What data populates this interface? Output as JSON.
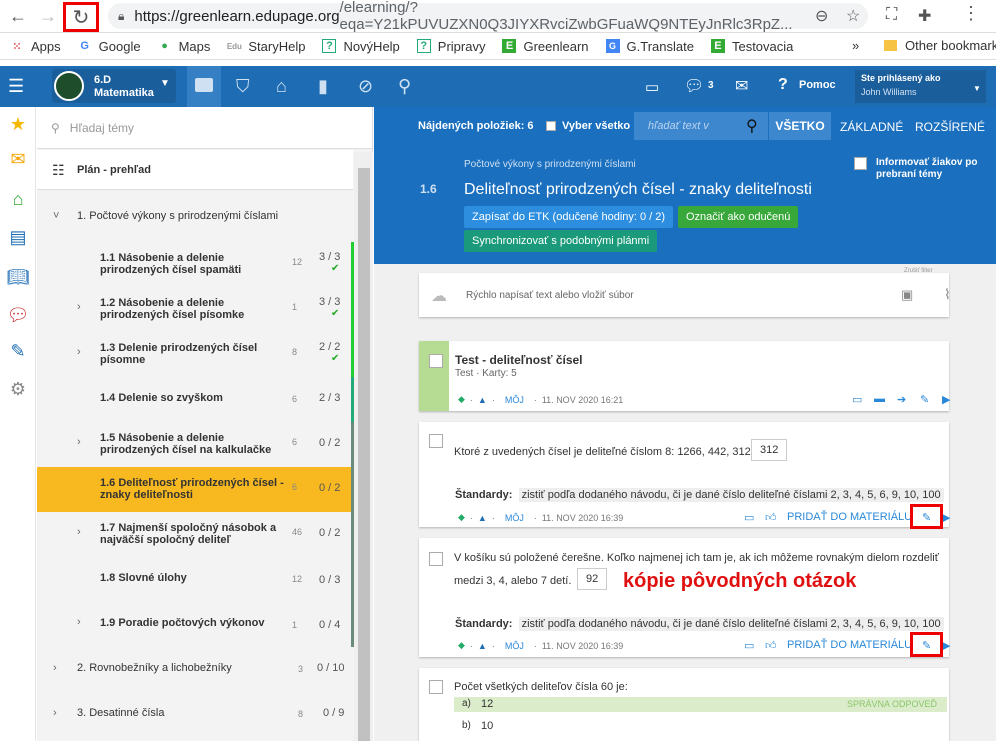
{
  "browser": {
    "url_domain": "https://greenlearn.edupage.org",
    "url_path": "/elearning/?eqa=Y21kPUVUZXN0Q3JIYXRvciZwbGFuaWQ9NTEyJnRlc3RpZ..."
  },
  "bookmarks": [
    {
      "label": "Apps",
      "icon": "apps-grid-icon"
    },
    {
      "label": "Google",
      "icon": "google-icon"
    },
    {
      "label": "Maps",
      "icon": "maps-pin-icon"
    },
    {
      "label": "StaryHelp",
      "icon": "edu-icon"
    },
    {
      "label": "NovýHelp",
      "icon": "help-question-icon"
    },
    {
      "label": "Pripravy",
      "icon": "help-question-icon"
    },
    {
      "label": "Greenlearn",
      "icon": "greenlearn-icon"
    },
    {
      "label": "G.Translate",
      "icon": "translate-icon"
    },
    {
      "label": "Testovacia",
      "icon": "greenlearn-icon"
    }
  ],
  "bookmarks_other": "Other bookmarks",
  "app": {
    "class_name": "6.D",
    "subject": "Matematika",
    "messages_count": "3",
    "help_label": "Pomoc",
    "logged_in_label": "Ste prihlásený ako",
    "user_name": "John Williams"
  },
  "plan": {
    "search_placeholder": "Hľadaj témy",
    "overview_label": "Plán - prehľad",
    "chapter1": "1. Počtové výkony s prirodzenými číslami",
    "topics": [
      {
        "title": "1.1  Násobenie a delenie prirodzených čísel spamäti",
        "count": "12",
        "score": "3 / 3",
        "done": "✔"
      },
      {
        "title": "1.2  Násobenie a delenie prirodzených čísel písomke",
        "count": "1",
        "score": "3 / 3",
        "done": "✔"
      },
      {
        "title": "1.3  Delenie prirodzených čísel písomne",
        "count": "8",
        "score": "2 / 2",
        "done": "✔"
      },
      {
        "title": "1.4  Delenie so zvyškom",
        "count": "6",
        "score": "2 / 3",
        "done": ""
      },
      {
        "title": "1.5  Násobenie a delenie prirodzených čísel na kalkulačke",
        "count": "6",
        "score": "0 / 2",
        "done": ""
      },
      {
        "title": "1.6  Deliteľnosť prirodzených čísel - znaky deliteľnosti",
        "count": "6",
        "score": "0 / 2",
        "done": ""
      },
      {
        "title": "1.7  Najmenší spoločný násobok a najväčší spoločný deliteľ",
        "count": "46",
        "score": "0 / 2",
        "done": ""
      },
      {
        "title": "1.8  Slovné úlohy",
        "count": "12",
        "score": "0 / 3",
        "done": ""
      },
      {
        "title": "1.9  Poradie počtových výkonov",
        "count": "1",
        "score": "0 / 4",
        "done": ""
      }
    ],
    "chapters": [
      {
        "title": "2.  Rovnobežníky a lichobežníky",
        "count": "3",
        "score": "0 / 10"
      },
      {
        "title": "3.  Desatinné čísla",
        "count": "8",
        "score": "0 / 9"
      }
    ]
  },
  "toolbar": {
    "found_label": "Nájdených položiek: 6",
    "select_all": "Vyber všetko",
    "search_placeholder": "hľadať text v",
    "tabs": [
      "VŠETKO",
      "ZÁKLADNÉ",
      "ROZŠÍRENÉ"
    ]
  },
  "topic": {
    "chapter": "Počtové výkony s prirodzenými číslami",
    "number": "1.6",
    "title": "Deliteľnosť prirodzených čísel - znaky deliteľnosti",
    "btn_etk": "Zapísať do ETK (odučené hodiny: 0 / 2)",
    "btn_mark": "Označiť ako odučenú",
    "btn_sync": "Synchronizovať s podobnými plánmi",
    "inform_label": "Informovať žiakov po prebraní témy",
    "hidden_label": "Zrušiť filter"
  },
  "composer": {
    "placeholder": "Rýchlo napísať text alebo vložiť súbor"
  },
  "items": {
    "test": {
      "title": "Test - deliteľnosť čísel",
      "sub": "Test · Karty: 5",
      "owner": "MÔJ",
      "date": "11. NOV 2020 16:21"
    },
    "q1": {
      "text": "Ktoré z uvedených čísel je deliteľné číslom 8: 1266, 442, 312",
      "answer": "312",
      "std_label": "Štandardy:",
      "std": "zistiť podľa dodaného návodu, či je dané číslo deliteľné číslami 2, 3, 4, 5, 6, 9, 10, 100",
      "owner": "MÔJ",
      "date": "11. NOV 2020 16:39",
      "add": "PRIDAŤ DO MATERIÁLU"
    },
    "q2": {
      "text1": "V košíku sú položené čerešne. Koľko najmenej ich tam je, ak ich môžeme rovnakým dielom rozdeliť",
      "text2": "medzi 3, 4, alebo 7 detí.",
      "answer": "92",
      "std_label": "Štandardy:",
      "std": "zistiť podľa dodaného návodu, či je dané číslo deliteľné číslami 2, 3, 4, 5, 6, 9, 10, 100",
      "owner": "MÔJ",
      "date": "11. NOV 2020 16:39",
      "add": "PRIDAŤ DO MATERIÁLU"
    },
    "q3": {
      "text": "Počet všetkých deliteľov čísla 60 je:",
      "a_label": "a)",
      "a": "12",
      "correct": "SPRÁVNA ODPOVEĎ",
      "b_label": "b)",
      "b": "10"
    }
  },
  "annotation": "kópie pôvodných otázok"
}
